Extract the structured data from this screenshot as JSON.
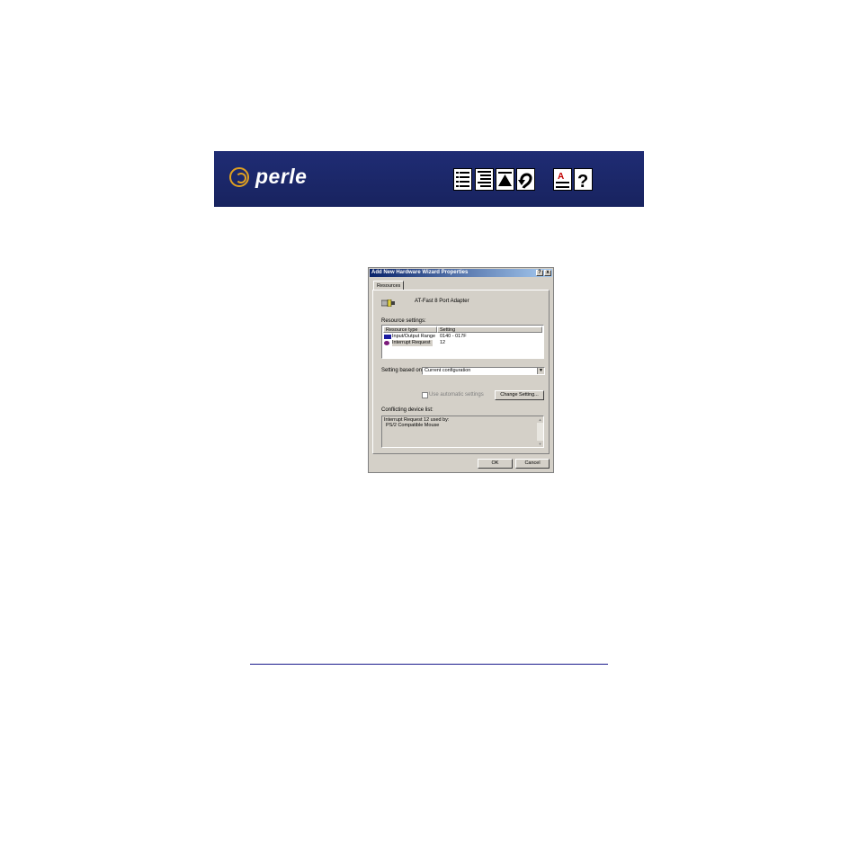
{
  "banner": {
    "brand": "perle",
    "colors": {
      "background": "#1f2c74",
      "logo_ring": "#e0a020"
    },
    "nav_icons": [
      "contents-icon",
      "index-icon",
      "top-of-page-icon",
      "back-icon",
      "glossary-icon",
      "help-icon"
    ]
  },
  "dialog": {
    "title": "Add New Hardware Wizard Properties",
    "help_btn": "?",
    "close_btn": "x",
    "tab": "Resources",
    "device_name": "AT-Fast 8 Port Adapter",
    "resource_settings_label": "Resource settings:",
    "columns": [
      "Resource type",
      "Setting"
    ],
    "rows": [
      {
        "type": "Input/Output Range",
        "setting": "0140 - 017F",
        "icon": "io-range-icon"
      },
      {
        "type": "Interrupt Request",
        "setting": "12",
        "icon": "irq-icon"
      }
    ],
    "setting_based_on_label": "Setting based on:",
    "setting_based_on_value": "Current configuration",
    "auto_settings_label": "Use automatic settings",
    "change_setting_btn": "Change Setting...",
    "conflict_label": "Conflicting device list:",
    "conflict_lines": [
      "Interrupt Request 12 used by:",
      "PS/2 Compatible Mouse"
    ],
    "ok_btn": "OK",
    "cancel_btn": "Cancel"
  }
}
